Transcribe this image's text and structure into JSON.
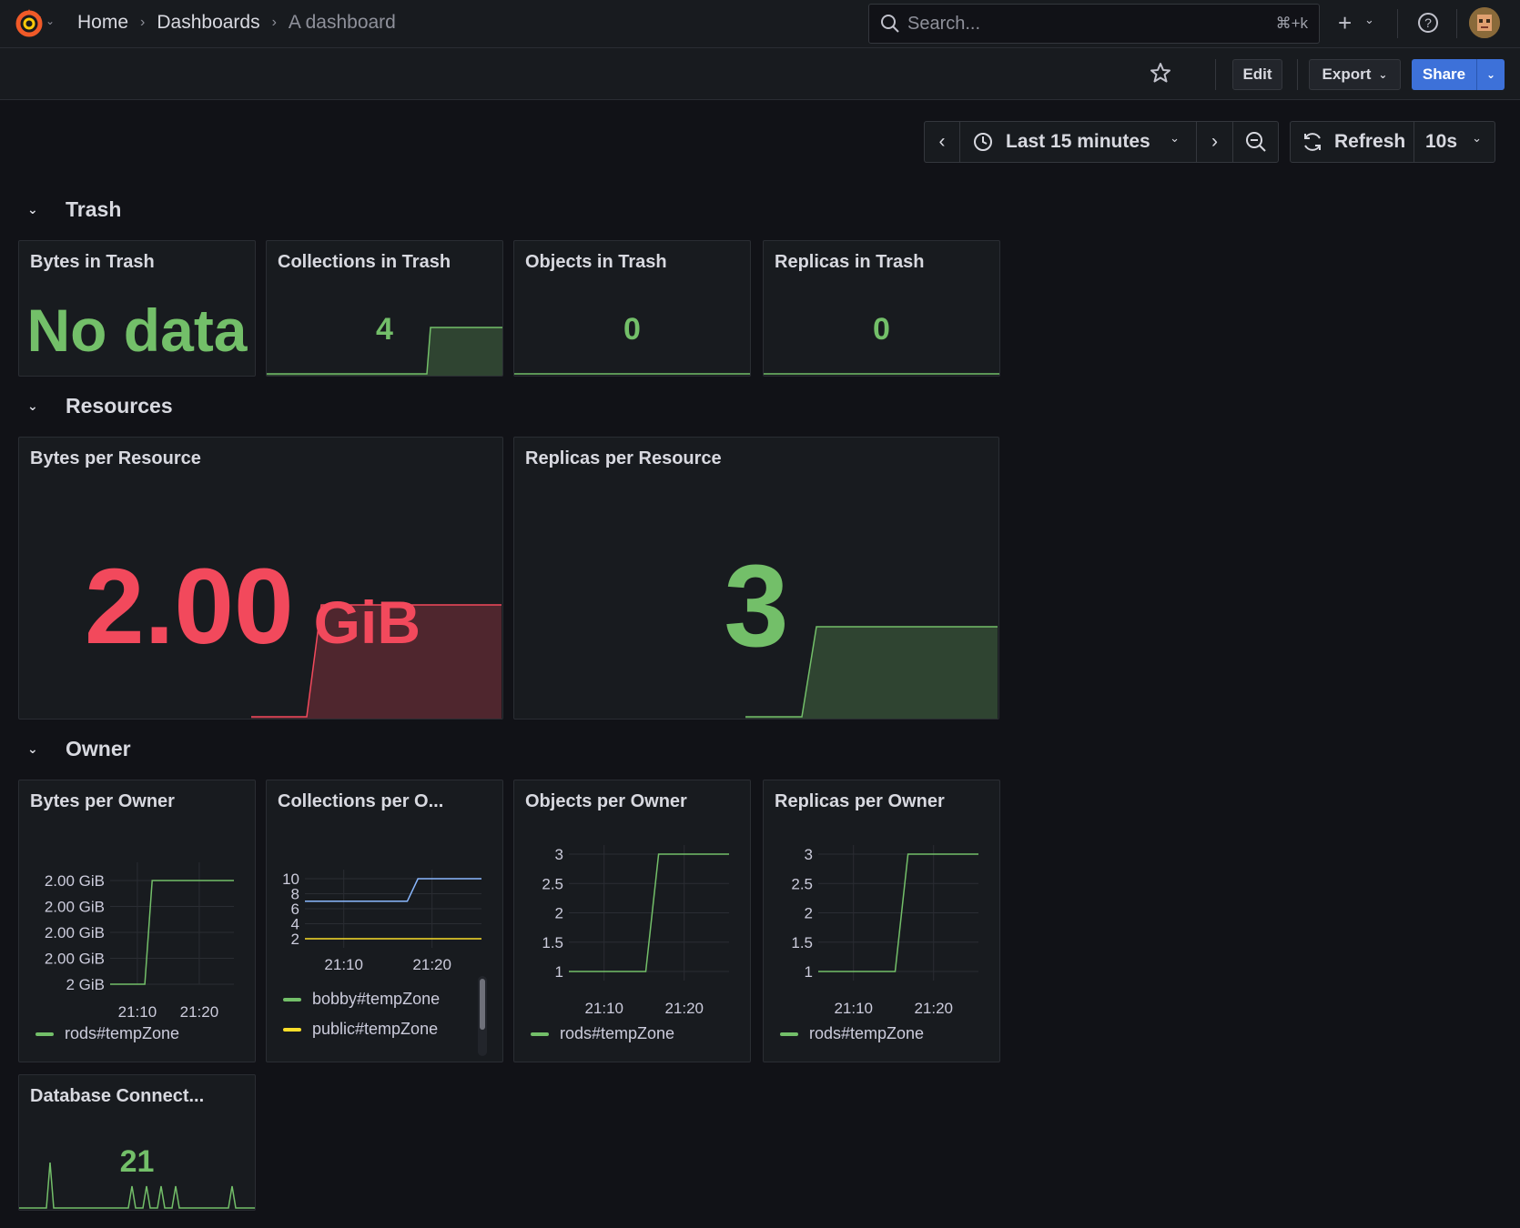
{
  "nav": {
    "breadcrumb": [
      "Home",
      "Dashboards",
      "A dashboard"
    ],
    "search_placeholder": "Search...",
    "search_shortcut": "⌘+k",
    "new_label": "+"
  },
  "toolbar": {
    "edit_label": "Edit",
    "export_label": "Export",
    "share_label": "Share"
  },
  "time": {
    "range_label": "Last 15 minutes",
    "refresh_label": "Refresh",
    "interval_label": "10s"
  },
  "colors": {
    "green": "#73bf69",
    "red": "#f2495c",
    "blue": "#8ab8ff",
    "yellow": "#fade2a",
    "accent": "#3d71d9"
  },
  "rows": {
    "trash": "Trash",
    "resources": "Resources",
    "owner": "Owner"
  },
  "panels": {
    "bytes_in_trash": {
      "title": "Bytes in Trash",
      "value": "No data"
    },
    "collections_in_trash": {
      "title": "Collections in Trash",
      "value": "4"
    },
    "objects_in_trash": {
      "title": "Objects in Trash",
      "value": "0"
    },
    "replicas_in_trash": {
      "title": "Replicas in Trash",
      "value": "0"
    },
    "bytes_per_resource": {
      "title": "Bytes per Resource",
      "value": "2.00",
      "unit": "GiB"
    },
    "replicas_per_resource": {
      "title": "Replicas per Resource",
      "value": "3"
    },
    "bytes_per_owner": {
      "title": "Bytes per Owner",
      "legend": [
        "rods#tempZone"
      ]
    },
    "collections_per_owner": {
      "title": "Collections per O...",
      "legend": [
        "bobby#tempZone",
        "public#tempZone"
      ]
    },
    "objects_per_owner": {
      "title": "Objects per Owner",
      "legend": [
        "rods#tempZone"
      ]
    },
    "replicas_per_owner": {
      "title": "Replicas per Owner",
      "legend": [
        "rods#tempZone"
      ]
    },
    "database_connections": {
      "title": "Database Connect...",
      "value": "21"
    }
  },
  "chart_data": [
    {
      "type": "line",
      "panel": "bytes_per_owner",
      "y_ticks": [
        "2.00 GiB",
        "2.00 GiB",
        "2.00 GiB",
        "2.00 GiB",
        "2 GiB"
      ],
      "x_ticks": [
        "21:10",
        "21:20"
      ],
      "series": [
        {
          "name": "rods#tempZone",
          "color": "#73bf69",
          "points": [
            [
              0.0,
              0
            ],
            [
              0.28,
              0
            ],
            [
              0.34,
              1
            ],
            [
              1.0,
              1
            ]
          ]
        }
      ]
    },
    {
      "type": "line",
      "panel": "collections_per_owner",
      "y_ticks": [
        "10",
        "8",
        "6",
        "4",
        "2"
      ],
      "x_ticks": [
        "21:10",
        "21:20"
      ],
      "ylim": [
        2,
        10
      ],
      "series": [
        {
          "name": "bobby#tempZone",
          "color": "#8ab8ff",
          "points": [
            [
              0.0,
              7
            ],
            [
              0.58,
              7
            ],
            [
              0.64,
              10
            ],
            [
              1.0,
              10
            ]
          ]
        },
        {
          "name": "public#tempZone",
          "color": "#fade2a",
          "points": [
            [
              0.0,
              2
            ],
            [
              1.0,
              2
            ]
          ]
        }
      ]
    },
    {
      "type": "line",
      "panel": "objects_per_owner",
      "y_ticks": [
        "3",
        "2.5",
        "2",
        "1.5",
        "1"
      ],
      "x_ticks": [
        "21:10",
        "21:20"
      ],
      "ylim": [
        1,
        3
      ],
      "series": [
        {
          "name": "rods#tempZone",
          "color": "#73bf69",
          "points": [
            [
              0.0,
              1
            ],
            [
              0.48,
              1
            ],
            [
              0.56,
              3
            ],
            [
              1.0,
              3
            ]
          ]
        }
      ]
    },
    {
      "type": "line",
      "panel": "replicas_per_owner",
      "y_ticks": [
        "3",
        "2.5",
        "2",
        "1.5",
        "1"
      ],
      "x_ticks": [
        "21:10",
        "21:20"
      ],
      "ylim": [
        1,
        3
      ],
      "series": [
        {
          "name": "rods#tempZone",
          "color": "#73bf69",
          "points": [
            [
              0.0,
              1
            ],
            [
              0.48,
              1
            ],
            [
              0.56,
              3
            ],
            [
              1.0,
              3
            ]
          ]
        }
      ]
    }
  ]
}
